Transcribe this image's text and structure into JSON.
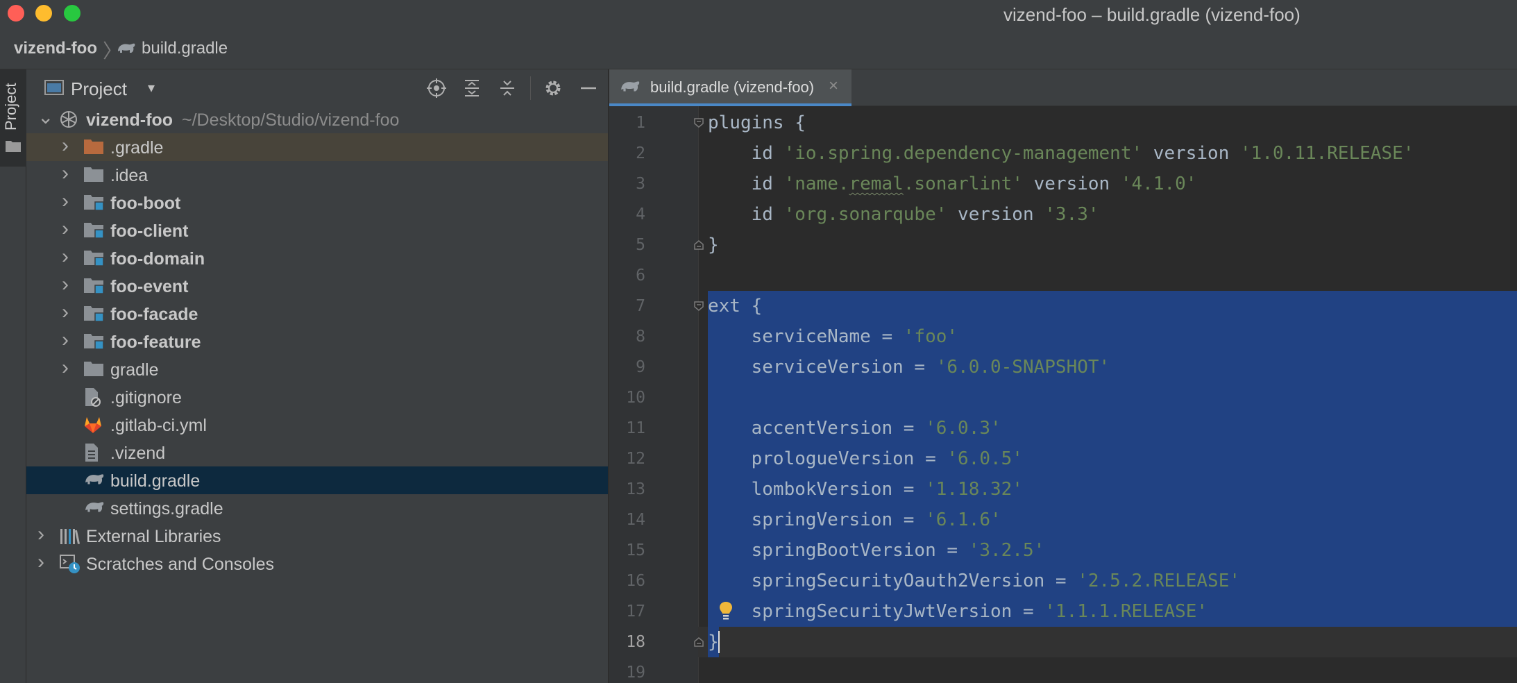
{
  "window": {
    "title": "vizend-foo – build.gradle (vizend-foo)"
  },
  "breadcrumb": {
    "root": "vizend-foo",
    "separator": "〉",
    "file": "build.gradle"
  },
  "toolstrip": {
    "tab_label": "Project"
  },
  "project_panel": {
    "title": "Project",
    "dropdown_glyph": "▾",
    "header_icons": [
      "locate-icon",
      "expand-all-icon",
      "collapse-all-icon",
      "gear-icon",
      "minimize-icon"
    ],
    "tree": [
      {
        "label": "vizend-foo",
        "path": "~/Desktop/Studio/vizend-foo",
        "icon": "module-root-icon",
        "expanded": true,
        "bold": true
      },
      {
        "label": ".gradle",
        "icon": "folder-orange-icon",
        "expanded": false,
        "bold": false
      },
      {
        "label": ".idea",
        "icon": "folder-icon",
        "expanded": false,
        "bold": false
      },
      {
        "label": "foo-boot",
        "icon": "module-folder-icon",
        "expanded": false,
        "bold": true
      },
      {
        "label": "foo-client",
        "icon": "module-folder-icon",
        "expanded": false,
        "bold": true
      },
      {
        "label": "foo-domain",
        "icon": "module-folder-icon",
        "expanded": false,
        "bold": true
      },
      {
        "label": "foo-event",
        "icon": "module-folder-icon",
        "expanded": false,
        "bold": true
      },
      {
        "label": "foo-facade",
        "icon": "module-folder-icon",
        "expanded": false,
        "bold": true
      },
      {
        "label": "foo-feature",
        "icon": "module-folder-icon",
        "expanded": false,
        "bold": true
      },
      {
        "label": "gradle",
        "icon": "folder-icon",
        "expanded": false,
        "bold": false
      },
      {
        "label": ".gitignore",
        "icon": "gitignore-icon",
        "bold": false
      },
      {
        "label": ".gitlab-ci.yml",
        "icon": "gitlab-icon",
        "bold": false
      },
      {
        "label": ".vizend",
        "icon": "text-file-icon",
        "bold": false
      },
      {
        "label": "build.gradle",
        "icon": "gradle-icon",
        "bold": false,
        "selected": true
      },
      {
        "label": "settings.gradle",
        "icon": "gradle-icon",
        "bold": false
      },
      {
        "label": "External Libraries",
        "icon": "libraries-icon",
        "expanded": false,
        "bold": false
      },
      {
        "label": "Scratches and Consoles",
        "icon": "scratches-icon",
        "expanded": false,
        "bold": false
      }
    ]
  },
  "editor": {
    "tab_label": "build.gradle (vizend-foo)",
    "tab_close": "×",
    "current_line": 18,
    "line_numbers": [
      "1",
      "2",
      "3",
      "4",
      "5",
      "6",
      "7",
      "8",
      "9",
      "10",
      "11",
      "12",
      "13",
      "14",
      "15",
      "16",
      "17",
      "18",
      "19"
    ],
    "lines": [
      [
        {
          "t": "plugins {",
          "c": "id"
        }
      ],
      [
        {
          "t": "    id ",
          "c": "id"
        },
        {
          "t": "'io.spring.dependency-management'",
          "c": "str"
        },
        {
          "t": " version ",
          "c": "id"
        },
        {
          "t": "'1.0.11.RELEASE'",
          "c": "str"
        }
      ],
      [
        {
          "t": "    id ",
          "c": "id"
        },
        {
          "t": "'name.",
          "c": "str"
        },
        {
          "t": "remal",
          "c": "str squig"
        },
        {
          "t": ".sonarlint'",
          "c": "str"
        },
        {
          "t": " version ",
          "c": "id"
        },
        {
          "t": "'4.1.0'",
          "c": "str"
        }
      ],
      [
        {
          "t": "    id ",
          "c": "id"
        },
        {
          "t": "'org.sonarqube'",
          "c": "str"
        },
        {
          "t": " version ",
          "c": "id"
        },
        {
          "t": "'3.3'",
          "c": "str"
        }
      ],
      [
        {
          "t": "}",
          "c": "id"
        }
      ],
      [],
      [
        {
          "t": "ext {",
          "c": "id"
        }
      ],
      [
        {
          "t": "    serviceName = ",
          "c": "id"
        },
        {
          "t": "'foo'",
          "c": "str"
        }
      ],
      [
        {
          "t": "    serviceVersion = ",
          "c": "id"
        },
        {
          "t": "'6.0.0-SNAPSHOT'",
          "c": "str"
        }
      ],
      [],
      [
        {
          "t": "    accentVersion = ",
          "c": "id"
        },
        {
          "t": "'6.0.3'",
          "c": "str"
        }
      ],
      [
        {
          "t": "    prologueVersion = ",
          "c": "id"
        },
        {
          "t": "'6.0.5'",
          "c": "str"
        }
      ],
      [
        {
          "t": "    lombokVersion = ",
          "c": "id"
        },
        {
          "t": "'1.18.32'",
          "c": "str"
        }
      ],
      [
        {
          "t": "    springVersion = ",
          "c": "id"
        },
        {
          "t": "'6.1.6'",
          "c": "str"
        }
      ],
      [
        {
          "t": "    springBootVersion = ",
          "c": "id"
        },
        {
          "t": "'3.2.5'",
          "c": "str"
        }
      ],
      [
        {
          "t": "    springSecurityOauth2Version = ",
          "c": "id"
        },
        {
          "t": "'2.5.2.RELEASE'",
          "c": "str"
        }
      ],
      [
        {
          "t": "    springSecurityJwtVersion = ",
          "c": "id"
        },
        {
          "t": "'1.1.1.RELEASE'",
          "c": "str"
        }
      ],
      [
        {
          "t": "}",
          "c": "id"
        }
      ],
      []
    ]
  },
  "colors": {
    "selection": "#214283",
    "string": "#6a8759",
    "identifier": "#a9b7c6",
    "tab_accent": "#4a88c7"
  }
}
